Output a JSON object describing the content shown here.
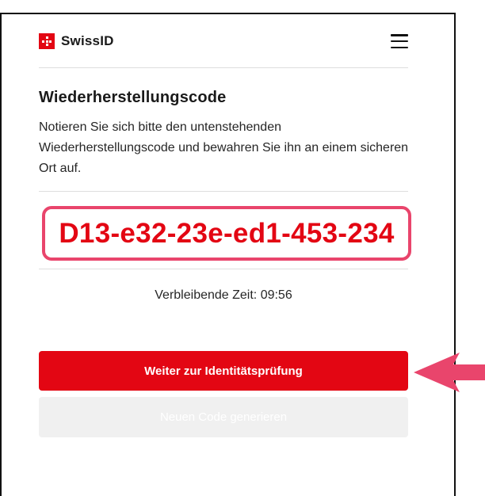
{
  "header": {
    "brand_name": "SwissID",
    "logo_icon": "swissid-logo-icon",
    "menu_icon": "hamburger-menu-icon"
  },
  "content": {
    "title": "Wiederherstellungscode",
    "description": "Notieren Sie sich bitte den untenstehenden Wiederherstellungscode und bewahren Sie ihn an einem sicheren Ort auf.",
    "recovery_code": "D13-e32-23e-ed1-453-234",
    "timer": "Verbleibende Zeit: 09:56"
  },
  "actions": {
    "primary_label": "Weiter zur Identitätsprüfung",
    "secondary_label": "Neuen Code generieren"
  },
  "colors": {
    "brand_red": "#e30613",
    "highlight_pink": "#e9456c",
    "disabled_bg": "#f0f0f0"
  },
  "annotations": {
    "arrow_icon": "left-arrow-icon"
  }
}
